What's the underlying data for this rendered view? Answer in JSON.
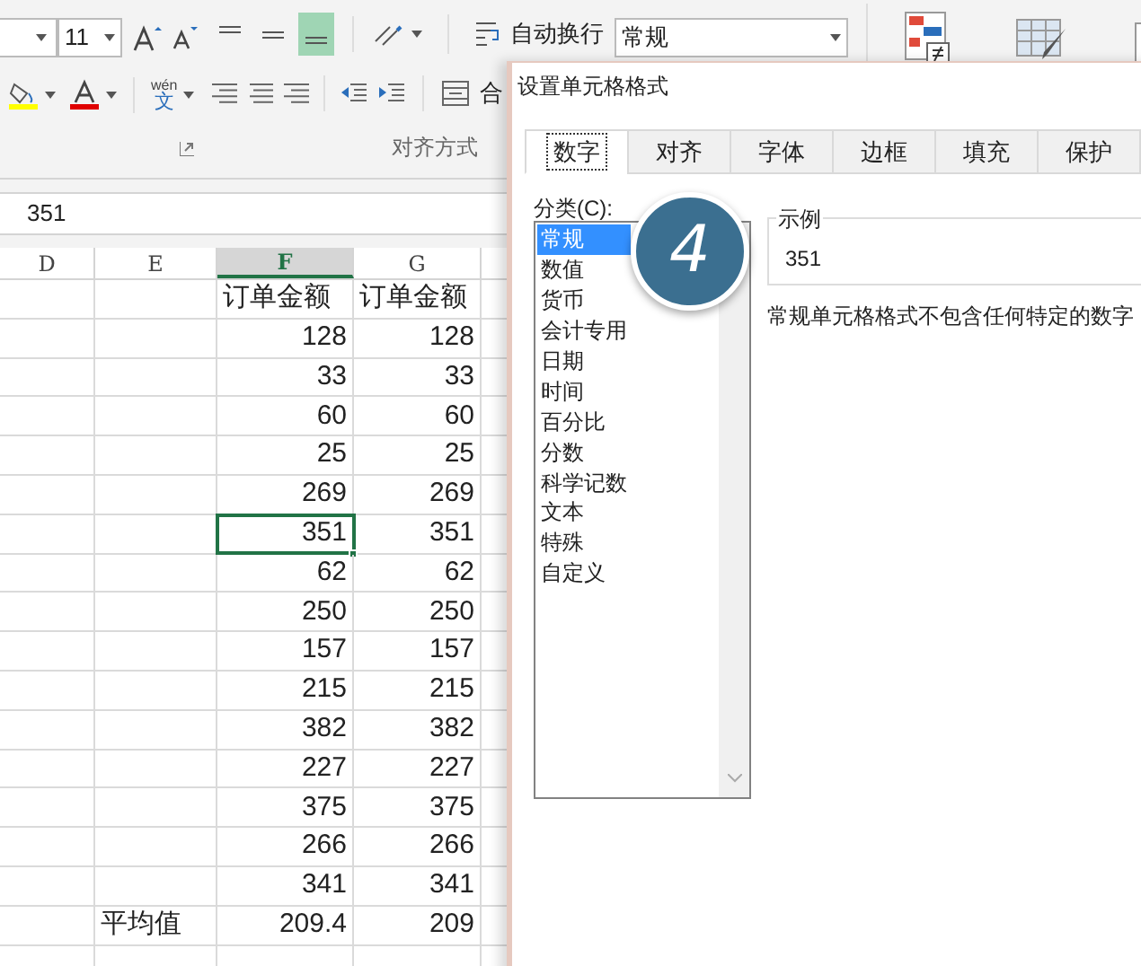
{
  "ribbon": {
    "font_size": "11",
    "align_buttons": [
      {
        "kind": "top",
        "selected": false
      },
      {
        "kind": "middle",
        "selected": false
      },
      {
        "kind": "bottom",
        "selected": true
      }
    ],
    "wrap_text": "自动换行",
    "merge_label": "合",
    "phonetic_label": "wén",
    "phonetic_char": "文",
    "group_label": "对齐方式",
    "number_format": "常规"
  },
  "formula_bar": {
    "value": "351"
  },
  "sheet": {
    "columns": [
      {
        "label": "D",
        "selected": false
      },
      {
        "label": "E",
        "selected": false
      },
      {
        "label": "F",
        "selected": true
      },
      {
        "label": "G",
        "selected": false
      }
    ],
    "rows": [
      {
        "e": "",
        "f": "订单金额",
        "g": "订单金额",
        "kind": "text",
        "selected": false
      },
      {
        "e": "",
        "f": "128",
        "g": "128",
        "kind": "number",
        "selected": false
      },
      {
        "e": "",
        "f": "33",
        "g": "33",
        "kind": "number",
        "selected": false
      },
      {
        "e": "",
        "f": "60",
        "g": "60",
        "kind": "number",
        "selected": false
      },
      {
        "e": "",
        "f": "25",
        "g": "25",
        "kind": "number",
        "selected": false
      },
      {
        "e": "",
        "f": "269",
        "g": "269",
        "kind": "number",
        "selected": false
      },
      {
        "e": "",
        "f": "351",
        "g": "351",
        "kind": "number",
        "selected": true
      },
      {
        "e": "",
        "f": "62",
        "g": "62",
        "kind": "number",
        "selected": false
      },
      {
        "e": "",
        "f": "250",
        "g": "250",
        "kind": "number",
        "selected": false
      },
      {
        "e": "",
        "f": "157",
        "g": "157",
        "kind": "number",
        "selected": false
      },
      {
        "e": "",
        "f": "215",
        "g": "215",
        "kind": "number",
        "selected": false
      },
      {
        "e": "",
        "f": "382",
        "g": "382",
        "kind": "number",
        "selected": false
      },
      {
        "e": "",
        "f": "227",
        "g": "227",
        "kind": "number",
        "selected": false
      },
      {
        "e": "",
        "f": "375",
        "g": "375",
        "kind": "number",
        "selected": false
      },
      {
        "e": "",
        "f": "266",
        "g": "266",
        "kind": "number",
        "selected": false
      },
      {
        "e": "",
        "f": "341",
        "g": "341",
        "kind": "number",
        "selected": false
      },
      {
        "e": "平均值",
        "f": "209.4",
        "g": "209",
        "kind": "number",
        "selected": false
      },
      {
        "e": "",
        "f": "",
        "g": "",
        "kind": "number",
        "selected": false
      }
    ]
  },
  "dialog": {
    "title": "设置单元格格式",
    "tabs": [
      {
        "label": "数字",
        "selected": true
      },
      {
        "label": "对齐",
        "selected": false
      },
      {
        "label": "字体",
        "selected": false
      },
      {
        "label": "边框",
        "selected": false
      },
      {
        "label": "填充",
        "selected": false
      },
      {
        "label": "保护",
        "selected": false
      }
    ],
    "category_label": "分类(C):",
    "categories": [
      {
        "label": "常规",
        "selected": true
      },
      {
        "label": "数值",
        "selected": false
      },
      {
        "label": "货币",
        "selected": false
      },
      {
        "label": "会计专用",
        "selected": false
      },
      {
        "label": "日期",
        "selected": false
      },
      {
        "label": "时间",
        "selected": false
      },
      {
        "label": "百分比",
        "selected": false
      },
      {
        "label": "分数",
        "selected": false
      },
      {
        "label": "科学记数",
        "selected": false
      },
      {
        "label": "文本",
        "selected": false
      },
      {
        "label": "特殊",
        "selected": false
      },
      {
        "label": "自定义",
        "selected": false
      }
    ],
    "sample": {
      "label": "示例",
      "value": "351"
    },
    "description": "常规单元格格式不包含任何特定的数字",
    "step_badge": "4"
  }
}
